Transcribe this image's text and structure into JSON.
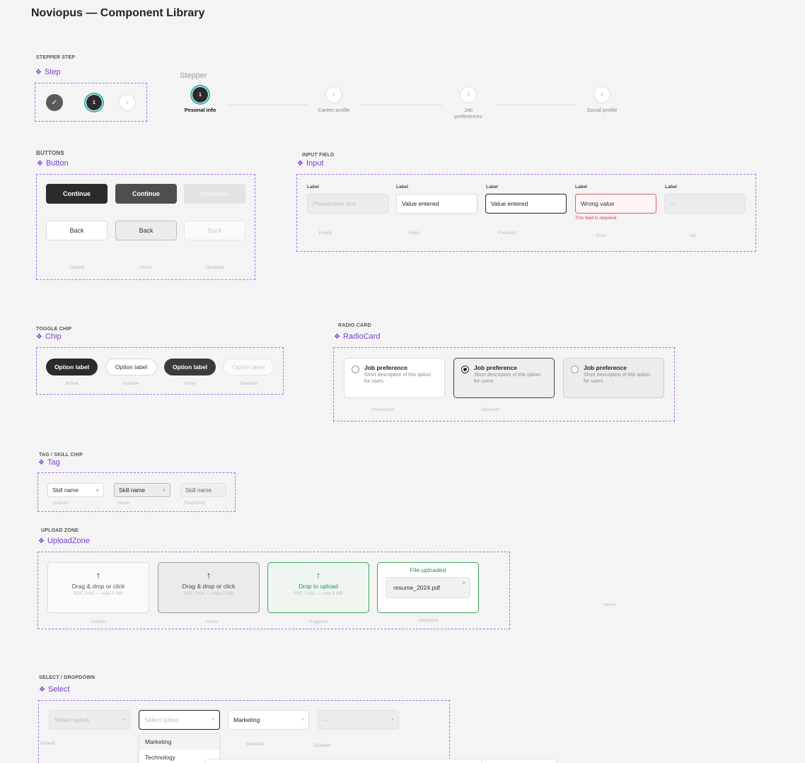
{
  "page_title": "Noviopus — Component Library",
  "diamond": "❖",
  "stepper_step": {
    "section": "STEPPER STEP",
    "component": "Step",
    "done_glyph": "✓",
    "active_number": "1",
    "idle_number": "1"
  },
  "stepper": {
    "title": "Stepper",
    "steps": [
      {
        "number": "1",
        "label": "Pesonal info"
      },
      {
        "number": "2",
        "label": "Career profile"
      },
      {
        "number": "3",
        "label": "Job preferences"
      },
      {
        "number": "4",
        "label": "Social profile"
      }
    ]
  },
  "buttons": {
    "section": "BUTTONS",
    "component": "Button",
    "primary_label": "Continue",
    "secondary_label": "Back",
    "states": [
      "Default",
      "Hover",
      "Disabled"
    ]
  },
  "input": {
    "section": "INPUT FIELD",
    "component": "Input",
    "label": "Label",
    "fields": [
      {
        "value": "Placeholder text",
        "state": "Empty"
      },
      {
        "value": "Value entered",
        "state": "Filled"
      },
      {
        "value": "Value entered",
        "state": "Focused"
      },
      {
        "value": "Wrong value",
        "state": "Error"
      },
      {
        "value": "—",
        "state": "NA"
      }
    ],
    "error_message": "This field is required"
  },
  "chip": {
    "section": "TOGGLE CHIP",
    "component": "Chip",
    "label": "Option label",
    "states": [
      "Active",
      "Inactive",
      "Hover",
      "Disabled"
    ]
  },
  "radio_card": {
    "section": "RADIO CARD",
    "component": "RadioCard",
    "title": "Job preference",
    "description": "Short description of this option for users",
    "states": [
      "Unselected",
      "Selected"
    ]
  },
  "tag": {
    "section": "TAG / SKILL CHIP",
    "component": "Tag",
    "label": "Skill name",
    "remove_glyph": "×",
    "states": [
      "Default",
      "Hover",
      "ReadOnly"
    ]
  },
  "upload": {
    "section": "UPLOAD ZONE",
    "component": "UploadZone",
    "arrow": "↑",
    "drag_text": "Drag & drop or click",
    "drop_text": "Drop to upload",
    "hint": "PDF, DOC — max 5 MB",
    "uploaded_title": "File uploaded",
    "file_name": "resume_2024.pdf",
    "remove_glyph": "×",
    "states": [
      "Default",
      "Hover",
      "Dragover",
      "Uploaded",
      "Hover"
    ]
  },
  "select": {
    "section": "SELECT / DROPDOWN",
    "component": "Select",
    "placeholder": "Select option",
    "selected_value": "Marketing",
    "disabled_value": "—",
    "caret": "▾",
    "options": [
      "Marketing",
      "Technology"
    ],
    "states": [
      "Default",
      "Selected",
      "Disabled"
    ]
  },
  "colors": {
    "accent_purple": "#7a3ed6",
    "frame_dashed": "#a970ef",
    "active_ring": "#2bb4b1",
    "error": "#d63b3b",
    "success": "#3ea45b"
  }
}
